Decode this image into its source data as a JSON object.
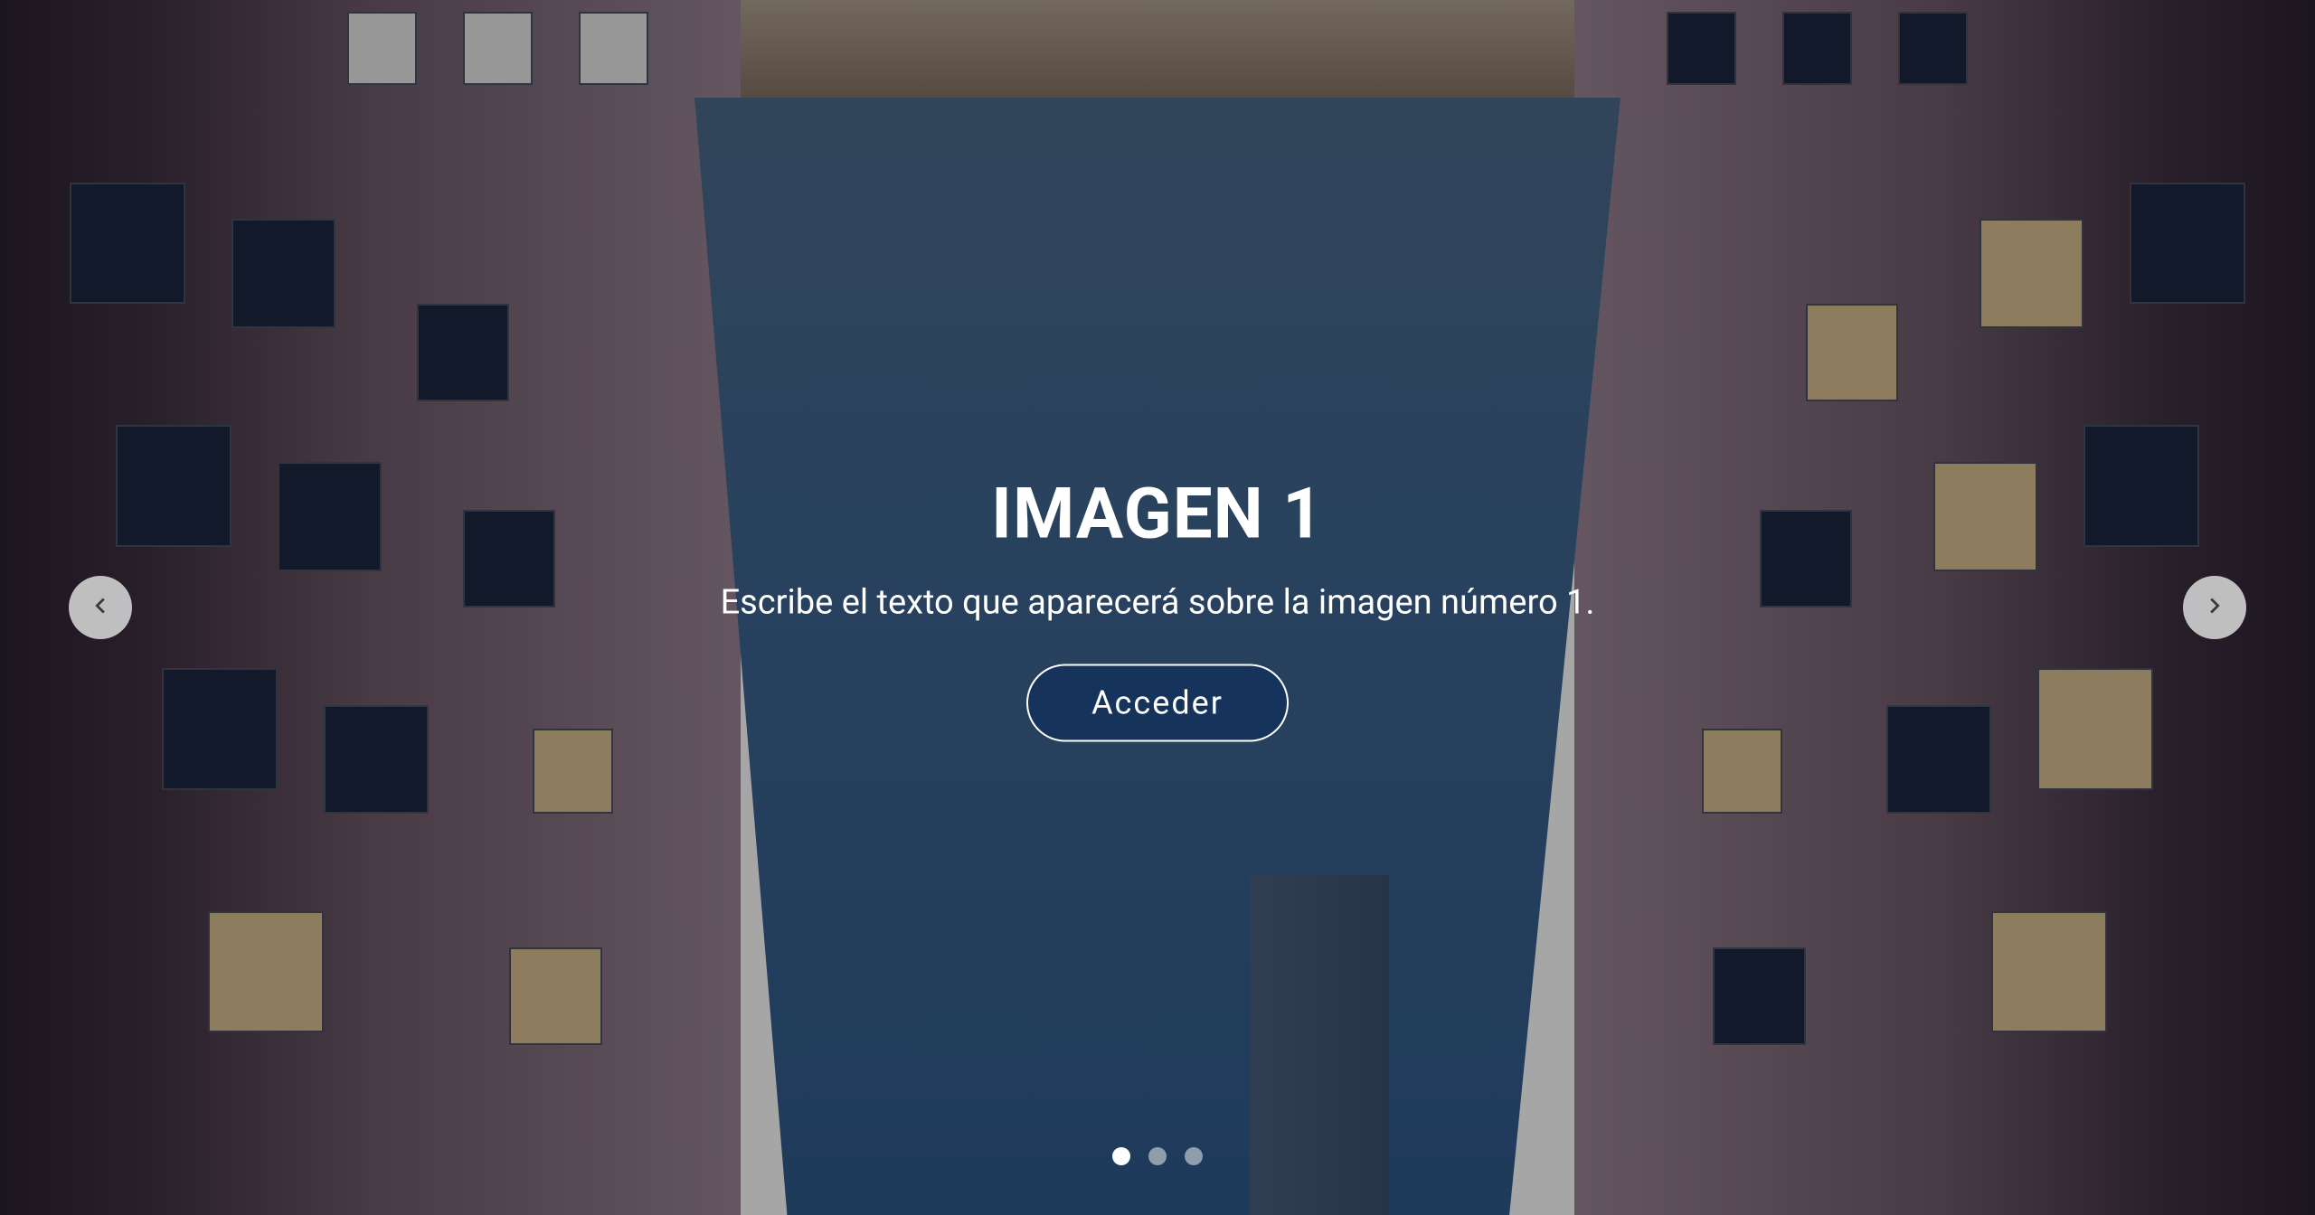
{
  "slide": {
    "title": "IMAGEN 1",
    "subtitle": "Escribe el texto que aparecerá sobre la imagen número 1.",
    "button_label": "Acceder"
  },
  "indicators": {
    "count": 3,
    "active_index": 0
  }
}
